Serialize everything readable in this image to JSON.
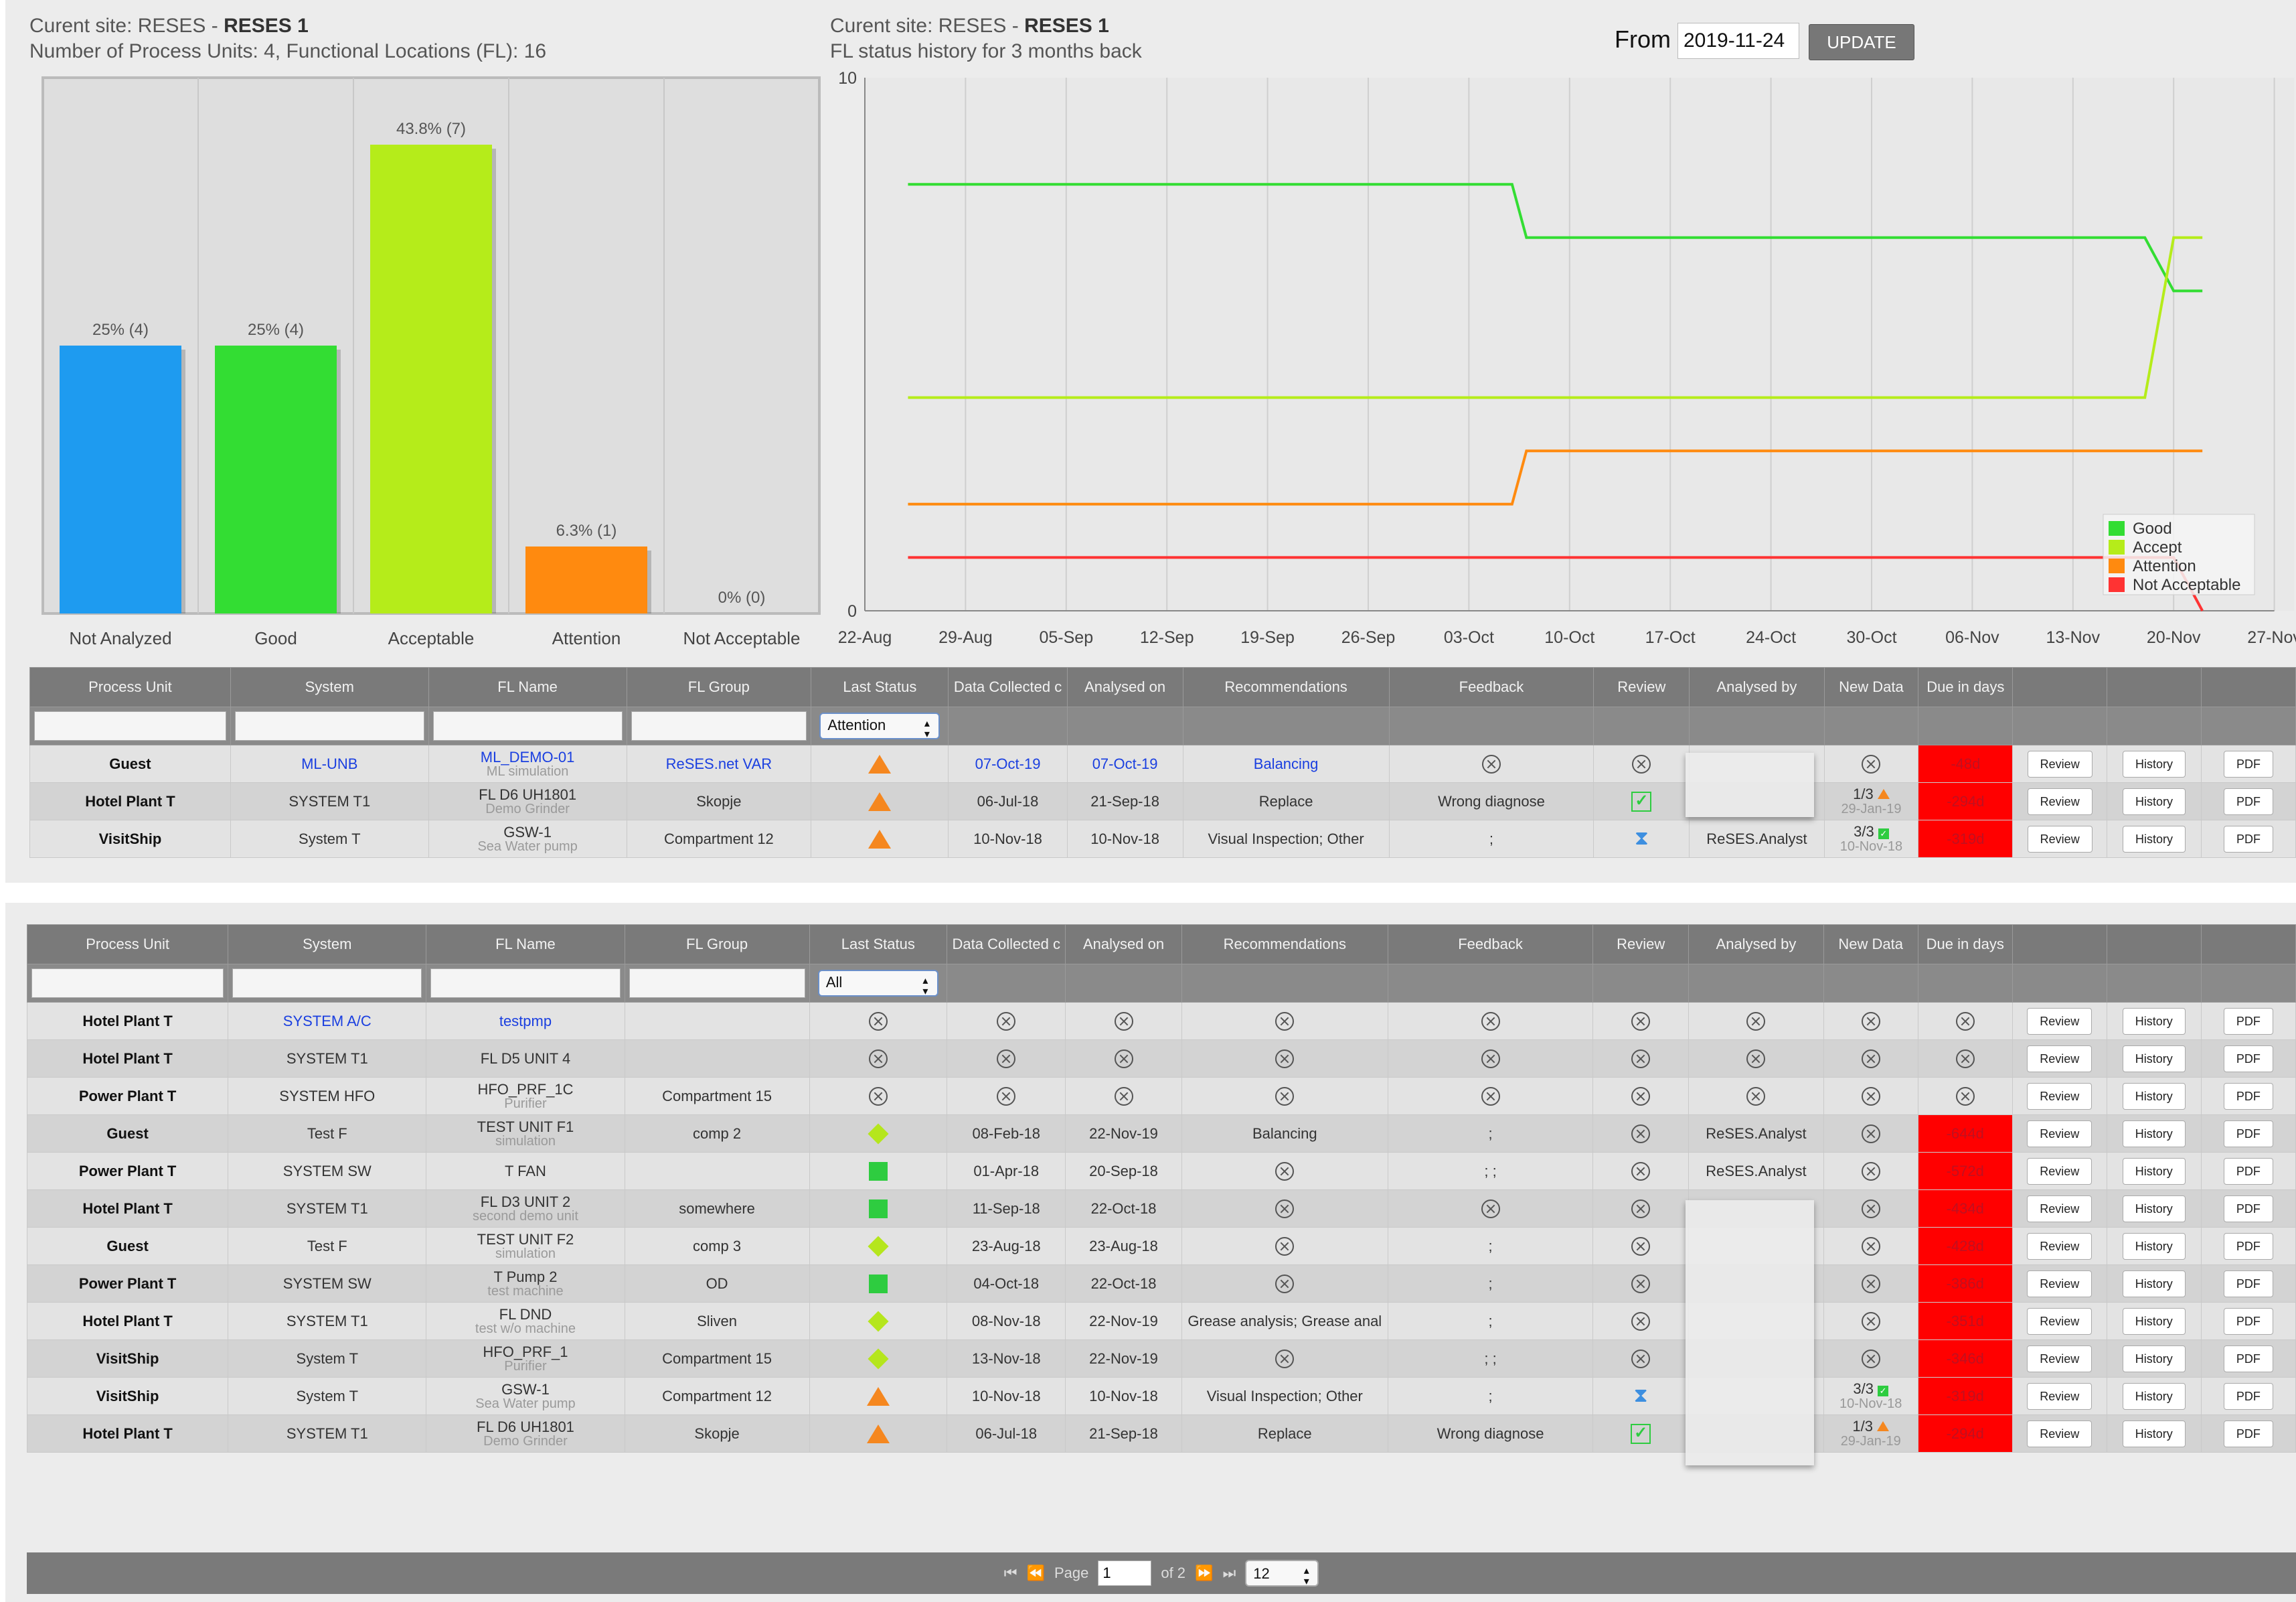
{
  "summary": {
    "site_label": "Curent site: RESES - ",
    "site_name": "RESES 1",
    "counts": "Number of Process Units: 4, Functional Locations (FL): 16",
    "history_title": "FL status history for 3 months back",
    "from_label": "From",
    "from_value": "2019-11-24",
    "update_label": "UPDATE"
  },
  "chart_data": [
    {
      "type": "bar",
      "categories": [
        "Not Analyzed",
        "Good",
        "Acceptable",
        "Attention",
        "Not Acceptable"
      ],
      "values": [
        4,
        4,
        7,
        1,
        0
      ],
      "percents": [
        "25%",
        "25%",
        "43.8%",
        "6.3%",
        "0%"
      ],
      "data_labels": [
        "25% (4)",
        "25% (4)",
        "43.8% (7)",
        "6.3% (1)",
        "0% (0)"
      ],
      "colors": [
        "#1e9bf0",
        "#33dd33",
        "#b5ec1a",
        "#ff8a0f",
        "#ff3333"
      ],
      "ylim": [
        0,
        8
      ],
      "grid": true
    },
    {
      "type": "line",
      "x_ticks": [
        "22-Aug",
        "29-Aug",
        "05-Sep",
        "12-Sep",
        "19-Sep",
        "26-Sep",
        "03-Oct",
        "10-Oct",
        "17-Oct",
        "24-Oct",
        "30-Oct",
        "06-Nov",
        "13-Nov",
        "20-Nov",
        "27-Nov"
      ],
      "y_ticks": [
        "0",
        "10"
      ],
      "ylim": [
        0,
        10
      ],
      "grid": true,
      "legend_position": "bottom-right",
      "series": [
        {
          "name": "Good",
          "color": "#33dd33",
          "points": [
            [
              "25-Aug",
              8
            ],
            [
              "06-Oct",
              8
            ],
            [
              "07-Oct",
              7
            ],
            [
              "19-Nov",
              7
            ],
            [
              "21-Nov",
              6
            ],
            [
              "23-Nov",
              6
            ]
          ]
        },
        {
          "name": "Accept",
          "color": "#b5ec1a",
          "points": [
            [
              "25-Aug",
              4
            ],
            [
              "19-Nov",
              4
            ],
            [
              "21-Nov",
              7
            ],
            [
              "23-Nov",
              7
            ]
          ]
        },
        {
          "name": "Attention",
          "color": "#ff8a0f",
          "points": [
            [
              "25-Aug",
              2
            ],
            [
              "06-Oct",
              2
            ],
            [
              "07-Oct",
              3
            ],
            [
              "23-Nov",
              3
            ]
          ]
        },
        {
          "name": "Not Acceptable",
          "color": "#ff3333",
          "points": [
            [
              "25-Aug",
              1
            ],
            [
              "21-Nov",
              1
            ],
            [
              "23-Nov",
              0
            ]
          ]
        }
      ]
    }
  ],
  "columns": [
    "Process Unit",
    "System",
    "FL Name",
    "FL Group",
    "Last Status",
    "Data Collected c",
    "Analysed on",
    "Recommendations",
    "Feedback",
    "Review",
    "Analysed by",
    "New Data",
    "Due in days",
    "",
    "",
    ""
  ],
  "table1": {
    "filter_status": "Attention",
    "rows": [
      {
        "pu": "Guest",
        "system": "ML-UNB",
        "fl": "ML_DEMO-01",
        "fl_sub": "ML simulation",
        "group": "ReSES.net VAR",
        "status": "attention",
        "collected": "07-Oct-19",
        "analysed": "07-Oct-19",
        "rec": "Balancing",
        "feedback": "x",
        "review": "x",
        "by": "",
        "newdata": "x",
        "due": "-48d",
        "link": true
      },
      {
        "pu": "Hotel Plant T",
        "system": "SYSTEM T1",
        "fl": "FL D6 UH1801",
        "fl_sub": "Demo Grinder",
        "group": "Skopje",
        "status": "attention",
        "collected": "06-Jul-18",
        "analysed": "21-Sep-18",
        "rec": "Replace",
        "feedback": "Wrong diagnose",
        "review": "check",
        "by": "",
        "newdata": "1/3",
        "newdata_icon": "attention",
        "newdata_date": "29-Jan-19",
        "due": "-294d"
      },
      {
        "pu": "VisitShip",
        "system": "System T",
        "fl": "GSW-1",
        "fl_sub": "Sea Water pump",
        "group": "Compartment 12",
        "status": "attention",
        "collected": "10-Nov-18",
        "analysed": "10-Nov-18",
        "rec": "Visual Inspection; Other",
        "feedback": ";",
        "review": "hourglass",
        "by": "ReSES.Analyst",
        "newdata": "3/3",
        "newdata_icon": "check",
        "newdata_date": "10-Nov-18",
        "due": "-319d"
      }
    ]
  },
  "table2": {
    "filter_status": "All",
    "rows": [
      {
        "pu": "Hotel Plant T",
        "system": "SYSTEM A/C",
        "fl": "testpmp",
        "fl_sub": "",
        "group": "",
        "status": "none",
        "collected": "x",
        "analysed": "x",
        "rec": "x",
        "feedback": "x",
        "review": "x",
        "by": "x",
        "newdata": "x",
        "due": "x",
        "link": true
      },
      {
        "pu": "Hotel Plant T",
        "system": "SYSTEM T1",
        "fl": "FL D5 UNIT 4",
        "fl_sub": "",
        "group": "",
        "status": "none",
        "collected": "x",
        "analysed": "x",
        "rec": "x",
        "feedback": "x",
        "review": "x",
        "by": "x",
        "newdata": "x",
        "due": "x"
      },
      {
        "pu": "Power Plant T",
        "system": "SYSTEM HFO",
        "fl": "HFO_PRF_1C",
        "fl_sub": "Purifier",
        "group": "Compartment 15",
        "status": "none",
        "collected": "x",
        "analysed": "x",
        "rec": "x",
        "feedback": "x",
        "review": "x",
        "by": "x",
        "newdata": "x",
        "due": "x"
      },
      {
        "pu": "Guest",
        "system": "Test F",
        "fl": "TEST UNIT F1",
        "fl_sub": "simulation",
        "group": "comp 2",
        "status": "acceptable",
        "collected": "08-Feb-18",
        "analysed": "22-Nov-19",
        "rec": "Balancing",
        "feedback": ";",
        "review": "x",
        "by": "ReSES.Analyst",
        "newdata": "x",
        "due": "-644d"
      },
      {
        "pu": "Power Plant T",
        "system": "SYSTEM SW",
        "fl": "T FAN",
        "fl_sub": "",
        "group": "",
        "status": "good",
        "collected": "01-Apr-18",
        "analysed": "20-Sep-18",
        "rec": "x",
        "feedback": "; ;",
        "review": "x",
        "by": "ReSES.Analyst",
        "newdata": "x",
        "due": "-572d"
      },
      {
        "pu": "Hotel Plant T",
        "system": "SYSTEM T1",
        "fl": "FL D3 UNIT 2",
        "fl_sub": "second demo unit",
        "group": "somewhere",
        "status": "good",
        "collected": "11-Sep-18",
        "analysed": "22-Oct-18",
        "rec": "x",
        "feedback": "x",
        "review": "x",
        "by": "",
        "newdata": "x",
        "due": "-434d"
      },
      {
        "pu": "Guest",
        "system": "Test F",
        "fl": "TEST UNIT F2",
        "fl_sub": "simulation",
        "group": "comp 3",
        "status": "acceptable",
        "collected": "23-Aug-18",
        "analysed": "23-Aug-18",
        "rec": "x",
        "feedback": ";",
        "review": "x",
        "by": "",
        "newdata": "x",
        "due": "-428d"
      },
      {
        "pu": "Power Plant T",
        "system": "SYSTEM SW",
        "fl": "T Pump 2",
        "fl_sub": "test machine",
        "group": "OD",
        "status": "good",
        "collected": "04-Oct-18",
        "analysed": "22-Oct-18",
        "rec": "x",
        "feedback": ";",
        "review": "x",
        "by": "",
        "newdata": "x",
        "due": "-386d"
      },
      {
        "pu": "Hotel Plant T",
        "system": "SYSTEM T1",
        "fl": "FL DND",
        "fl_sub": "test w/o machine",
        "group": "Sliven",
        "status": "acceptable",
        "collected": "08-Nov-18",
        "analysed": "22-Nov-19",
        "rec": "Grease analysis; Grease anal",
        "feedback": ";",
        "review": "x",
        "by": "",
        "newdata": "x",
        "due": "-351d"
      },
      {
        "pu": "VisitShip",
        "system": "System T",
        "fl": "HFO_PRF_1",
        "fl_sub": "Purifier",
        "group": "Compartment 15",
        "status": "acceptable",
        "collected": "13-Nov-18",
        "analysed": "22-Nov-19",
        "rec": "x",
        "feedback": "; ;",
        "review": "x",
        "by": "",
        "newdata": "x",
        "due": "-346d"
      },
      {
        "pu": "VisitShip",
        "system": "System T",
        "fl": "GSW-1",
        "fl_sub": "Sea Water pump",
        "group": "Compartment 12",
        "status": "attention",
        "collected": "10-Nov-18",
        "analysed": "10-Nov-18",
        "rec": "Visual Inspection; Other",
        "feedback": ";",
        "review": "hourglass",
        "by": "",
        "newdata": "3/3",
        "newdata_icon": "check",
        "newdata_date": "10-Nov-18",
        "due": "-319d"
      },
      {
        "pu": "Hotel Plant T",
        "system": "SYSTEM T1",
        "fl": "FL D6 UH1801",
        "fl_sub": "Demo Grinder",
        "group": "Skopje",
        "status": "attention",
        "collected": "06-Jul-18",
        "analysed": "21-Sep-18",
        "rec": "Replace",
        "feedback": "Wrong diagnose",
        "review": "check",
        "by": "",
        "newdata": "1/3",
        "newdata_icon": "attention",
        "newdata_date": "29-Jan-19",
        "due": "-294d"
      }
    ]
  },
  "actions": {
    "review": "Review",
    "history": "History",
    "pdf": "PDF"
  },
  "pager": {
    "page_label": "Page",
    "page_value": "1",
    "of_label": "of 2",
    "per_page": "12"
  }
}
